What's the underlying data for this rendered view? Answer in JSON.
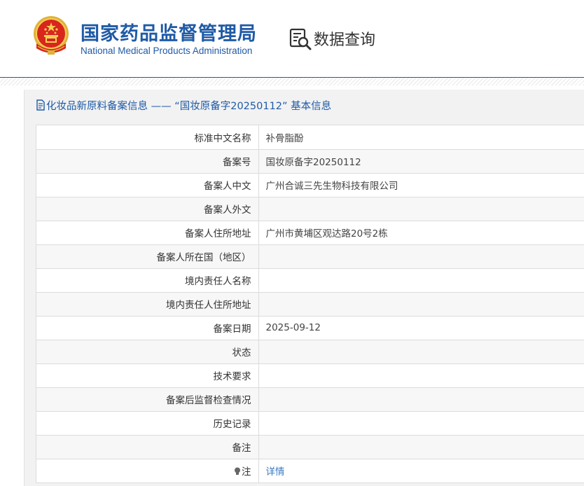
{
  "header": {
    "org_name_cn": "国家药品监督管理局",
    "org_name_en": "National Medical Products Administration",
    "query_label": "数据查询"
  },
  "panel": {
    "title": "化妆品新原料备案信息 —— “国妆原备字20250112” 基本信息"
  },
  "rows": [
    {
      "label": "标准中文名称",
      "value": "补骨脂酚"
    },
    {
      "label": "备案号",
      "value": "国妆原备字20250112"
    },
    {
      "label": "备案人中文",
      "value": "广州合诚三先生物科技有限公司"
    },
    {
      "label": "备案人外文",
      "value": ""
    },
    {
      "label": "备案人住所地址",
      "value": "广州市黄埔区观达路20号2栋"
    },
    {
      "label": "备案人所在国（地区）",
      "value": ""
    },
    {
      "label": "境内责任人名称",
      "value": ""
    },
    {
      "label": "境内责任人住所地址",
      "value": ""
    },
    {
      "label": "备案日期",
      "value": "2025-09-12"
    },
    {
      "label": "状态",
      "value": ""
    },
    {
      "label": "技术要求",
      "value": ""
    },
    {
      "label": "备案后监督检查情况",
      "value": ""
    },
    {
      "label": "历史记录",
      "value": ""
    },
    {
      "label": "备注",
      "value": ""
    }
  ],
  "note_row": {
    "label": "注",
    "link_text": "详情",
    "icon": "lightbulb-icon"
  },
  "colors": {
    "brand_blue": "#1f5aa6",
    "link_blue": "#3b7bc4"
  }
}
